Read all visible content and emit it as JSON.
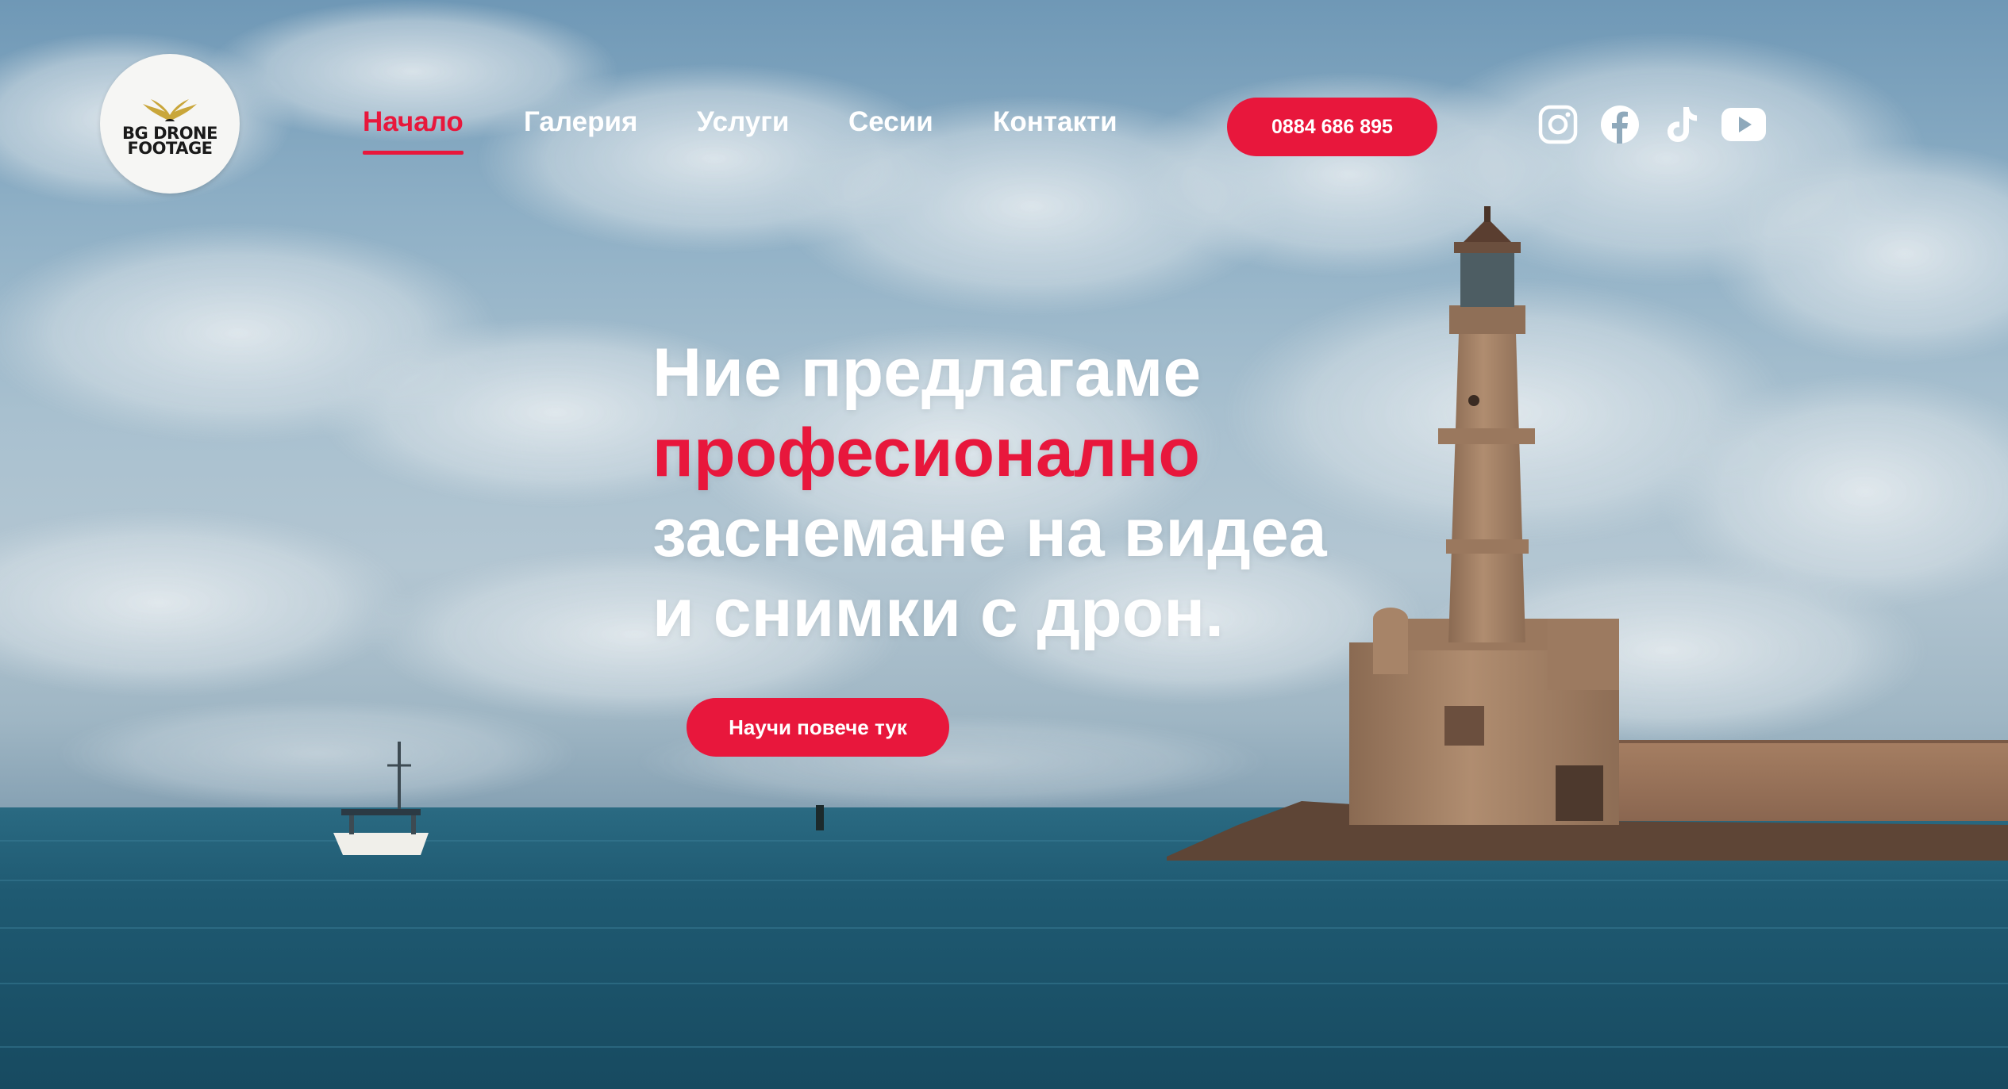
{
  "logo": {
    "line1": "BG DRONE",
    "line2": "FOOTAGE"
  },
  "nav": {
    "items": [
      {
        "label": "Начало",
        "active": true
      },
      {
        "label": "Галерия",
        "active": false
      },
      {
        "label": "Услуги",
        "active": false
      },
      {
        "label": "Сесии",
        "active": false
      },
      {
        "label": "Контакти",
        "active": false
      }
    ]
  },
  "header": {
    "phone_label": "0884 686 895"
  },
  "socials": [
    "instagram-icon",
    "facebook-icon",
    "tiktok-icon",
    "youtube-icon"
  ],
  "hero": {
    "line1": "Ние предлагаме",
    "line2": "професионално",
    "line3": "заснемане на видеа",
    "line4": "и снимки с дрон.",
    "cta_label": "Научи повече тук"
  },
  "colors": {
    "accent": "#e8173c",
    "text": "#ffffff",
    "sea": "#1f5a72"
  }
}
